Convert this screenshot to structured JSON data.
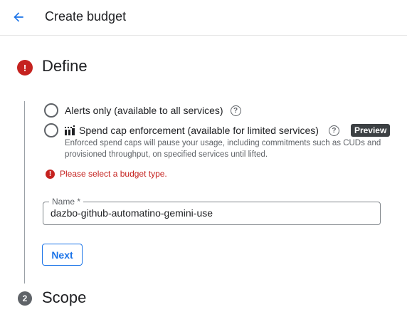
{
  "header": {
    "title": "Create budget",
    "back_icon": "arrow-back-icon"
  },
  "steps": [
    {
      "number": "!",
      "title": "Define",
      "state": "error"
    },
    {
      "number": "2",
      "title": "Scope",
      "state": "pending"
    }
  ],
  "budget_type": {
    "options": [
      {
        "label": "Alerts only (available to all services)",
        "selected": false
      },
      {
        "label": "Spend cap enforcement (available for limited services)",
        "selected": false,
        "badge": "Preview"
      }
    ],
    "help_glyph": "?",
    "spend_cap_description": "Enforced spend caps will pause your usage, including commitments such as CUDs and provisioned throughput, on specified services until lifted.",
    "error": "Please select a budget type."
  },
  "name_field": {
    "label": "Name *",
    "value": "dazbo-github-automatino-gemini-use"
  },
  "next_button": {
    "label": "Next"
  },
  "colors": {
    "accent": "#1a73e8",
    "error": "#c5221f",
    "text": "#202124",
    "muted": "#5f6368"
  }
}
